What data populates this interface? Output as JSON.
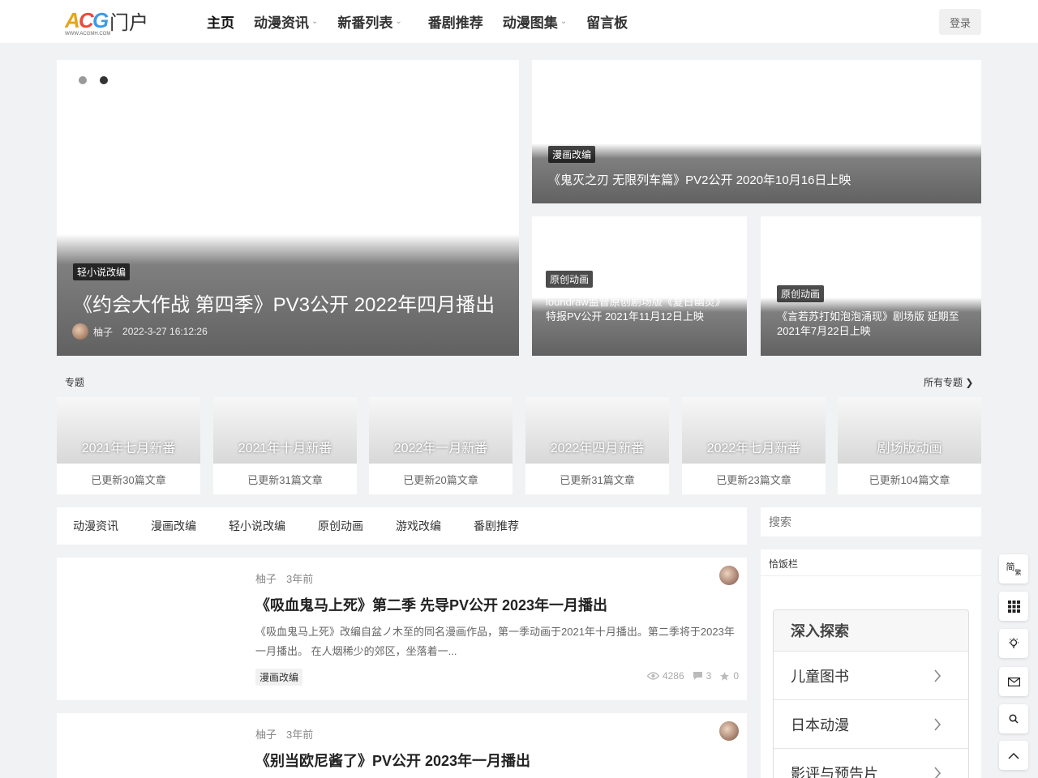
{
  "header": {
    "logo_text": "ACG门户",
    "nav": [
      {
        "label": "主页",
        "dropdown": false,
        "active": true
      },
      {
        "label": "动漫资讯",
        "dropdown": true
      },
      {
        "label": "新番列表",
        "dropdown": true
      },
      {
        "label": "番剧推荐",
        "dropdown": false
      },
      {
        "label": "动漫图集",
        "dropdown": true
      },
      {
        "label": "留言板",
        "dropdown": false
      }
    ],
    "login_label": "登录"
  },
  "hero": {
    "main": {
      "tag": "轻小说改编",
      "title": "《约会大作战 第四季》PV3公开 2022年四月播出",
      "author": "柚子",
      "date": "2022-3-27 16:12:26"
    },
    "side_top": {
      "tag": "漫画改编",
      "title": "《鬼灭之刃 无限列车篇》PV2公开 2020年10月16日上映"
    },
    "side_left": {
      "tag": "原创动画",
      "title": "loundraw监督原创剧场版《夏日幽灵》特报PV公开 2021年11月12日上映"
    },
    "side_right": {
      "tag": "原创动画",
      "title": "《言若苏打如泡泡涌现》剧场版 延期至2021年7月22日上映"
    }
  },
  "topics": {
    "heading": "专题",
    "all_label": "所有专题 ❯",
    "items": [
      {
        "name": "2021年七月新番",
        "count": "已更新30篇文章"
      },
      {
        "name": "2021年十月新番",
        "count": "已更新31篇文章"
      },
      {
        "name": "2022年一月新番",
        "count": "已更新20篇文章"
      },
      {
        "name": "2022年四月新番",
        "count": "已更新31篇文章"
      },
      {
        "name": "2022年七月新番",
        "count": "已更新23篇文章"
      },
      {
        "name": "剧场版动画",
        "count": "已更新104篇文章"
      }
    ]
  },
  "categories": [
    "动漫资讯",
    "漫画改编",
    "轻小说改编",
    "原创动画",
    "游戏改编",
    "番剧推荐"
  ],
  "posts": [
    {
      "author": "柚子",
      "time": "3年前",
      "title": "《吸血鬼马上死》第二季 先导PV公开 2023年一月播出",
      "excerpt": "《吸血鬼马上死》改编自盆ノ木至的同名漫画作品，第一季动画于2021年十月播出。第二季将于2023年一月播出。 在人烟稀少的郊区，坐落着一...",
      "tag": "漫画改编",
      "views": "4286",
      "comments": "3",
      "likes": "0"
    },
    {
      "author": "柚子",
      "time": "3年前",
      "title": "《别当欧尼酱了》PV公开 2023年一月播出"
    }
  ],
  "sidebar": {
    "search_placeholder": "搜索",
    "widget_title": "恰饭栏",
    "explore": {
      "heading": "深入探索",
      "items": [
        "儿童图书",
        "日本动漫",
        "影评与预告片"
      ]
    }
  },
  "tools": {
    "lang_main": "简",
    "lang_sub": "繁"
  },
  "colors": {
    "page_bg": "#f1f2f3",
    "card_bg": "#ffffff",
    "tag_bg": "rgba(0,0,0,0.7)"
  }
}
